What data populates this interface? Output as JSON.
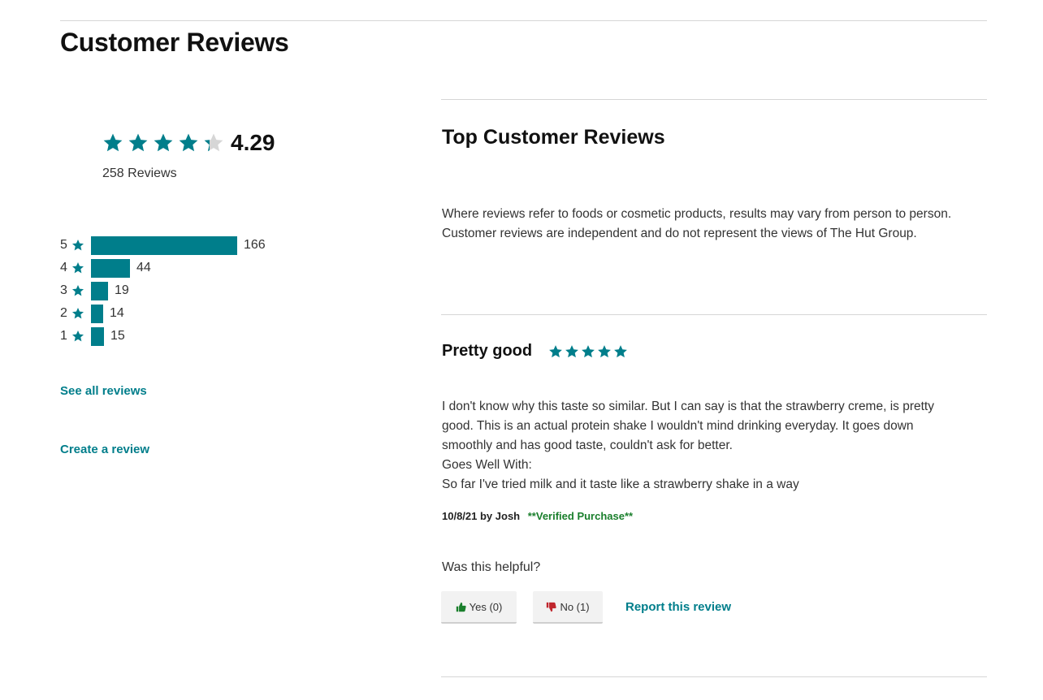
{
  "colors": {
    "accent": "#007e8b",
    "star_empty": "#d6d6d6",
    "verified": "#1a7f2c",
    "thumb_up": "#1a7f2c",
    "thumb_down": "#c0262d"
  },
  "section": {
    "title": "Customer Reviews"
  },
  "summary": {
    "average": "4.29",
    "average_value": 4.29,
    "max_stars": 5,
    "count_label": "258 Reviews",
    "star_icon": "star-icon"
  },
  "histogram": {
    "rows": [
      {
        "stars": "5",
        "count": "166",
        "value": 166
      },
      {
        "stars": "4",
        "count": "44",
        "value": 44
      },
      {
        "stars": "3",
        "count": "19",
        "value": 19
      },
      {
        "stars": "2",
        "count": "14",
        "value": 14
      },
      {
        "stars": "1",
        "count": "15",
        "value": 15
      }
    ]
  },
  "links": {
    "see_all": "See all reviews",
    "create": "Create a review"
  },
  "top_reviews": {
    "title": "Top Customer Reviews",
    "disclaimer": "Where reviews refer to foods or cosmetic products, results may vary from person to person. Customer reviews are independent and do not represent the views of The Hut Group."
  },
  "review": {
    "title": "Pretty good",
    "rating": 5,
    "body_lines": [
      "I don't know why this taste so similar. But I can say is that the strawberry creme, is pretty",
      "good. This is an actual protein shake I wouldn't mind drinking everyday. It goes down",
      "smoothly and has good taste, couldn't ask for better.",
      "Goes Well With:",
      "So far I've tried milk and it taste like a strawberry shake in a way"
    ],
    "meta": "10/8/21 by Josh",
    "verified": "**Verified Purchase**",
    "helpful_question": "Was this helpful?",
    "yes_label": "Yes (0)",
    "no_label": "No (1)",
    "report_label": "Report this review",
    "yes_icon": "thumbs-up-icon",
    "no_icon": "thumbs-down-icon"
  }
}
